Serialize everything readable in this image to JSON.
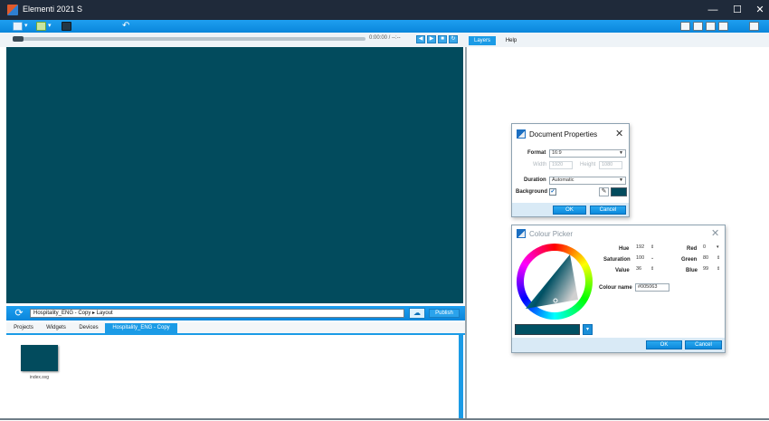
{
  "window": {
    "title": "Elementi 2021 S",
    "minimize": "—",
    "maximize": "☐",
    "close": "✕"
  },
  "player": {
    "timecode": "0:00:00 / --:--"
  },
  "right_panel": {
    "tabs": [
      "Layers",
      "Help"
    ]
  },
  "breadcrumb": {
    "path": "Hospitality_ENG - Copy  ▸  Layout",
    "publish_label": "Publish",
    "cloud_glyph": "☁"
  },
  "bottom_tabs": [
    "Projects",
    "Widgets",
    "Devices",
    "Hospitality_ENG - Copy"
  ],
  "files": [
    {
      "name": "index.svg"
    }
  ],
  "canvas_color": "#024b5d",
  "doc_props": {
    "title": "Document Properties",
    "format_label": "Format",
    "format_value": "16:9",
    "width_label": "Width",
    "width_value": "1920",
    "height_label": "Height",
    "height_value": "1080",
    "duration_label": "Duration",
    "duration_value": "Automatic",
    "background_label": "Background",
    "background_checked": "✔",
    "background_color": "#024b5d",
    "ok_label": "OK",
    "cancel_label": "Cancel"
  },
  "colour_picker": {
    "title": "Colour Picker",
    "hue_label": "Hue",
    "hue_value": "192",
    "saturation_label": "Saturation",
    "saturation_value": "100",
    "value_label": "Value",
    "value_value": "36",
    "red_label": "Red",
    "red_value": "0",
    "green_label": "Green",
    "green_value": "80",
    "blue_label": "Blue",
    "blue_value": "99",
    "colour_name_label": "Colour name",
    "colour_name_value": "#005063",
    "swatch_color": "#005063",
    "ok_label": "OK",
    "cancel_label": "Cancel"
  }
}
